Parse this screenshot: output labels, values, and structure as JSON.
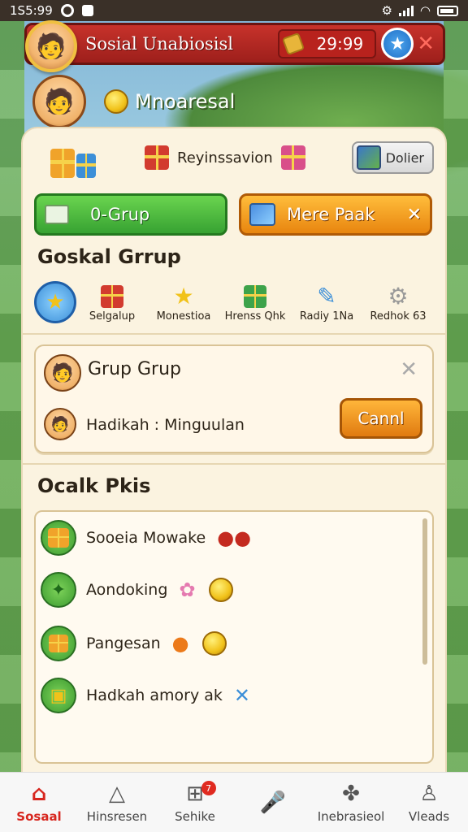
{
  "status_bar": {
    "time": "1S5:99"
  },
  "header": {
    "title": "Sosial Unabiosisl",
    "timer": "29:99",
    "accent_color": "#c7322b"
  },
  "profile": {
    "name": "Mnoaresal"
  },
  "gifts_row": {
    "label": "Reyinssavion",
    "dolier_label": "Dolier"
  },
  "actions": {
    "green_label": "0-Grup",
    "orange_label": "Mere Paak"
  },
  "categories": {
    "title": "Goskal Grrup",
    "items": [
      {
        "label": "Selgalup"
      },
      {
        "label": "Monestioa"
      },
      {
        "label": "Hrenss Qhk"
      },
      {
        "label": "Radiy 1Na"
      },
      {
        "label": "Redhok 63"
      }
    ]
  },
  "grup_card": {
    "title": "Grup Grup",
    "subtitle": "Hadikah : Minguulan",
    "button_label": "Cannl"
  },
  "list_section": {
    "title": "Ocalk Pkis",
    "items": [
      {
        "label": "Sooeia Mowake"
      },
      {
        "label": "Aondoking"
      },
      {
        "label": "Pangesan"
      },
      {
        "label": "Hadkah amory ak"
      }
    ]
  },
  "bottom_nav": {
    "items": [
      {
        "label": "Sosaal"
      },
      {
        "label": "Hinsresen"
      },
      {
        "label": "Sehike",
        "badge": "7"
      },
      {
        "label": ""
      },
      {
        "label": "Inebrasieol"
      },
      {
        "label": "Vleads"
      }
    ]
  }
}
